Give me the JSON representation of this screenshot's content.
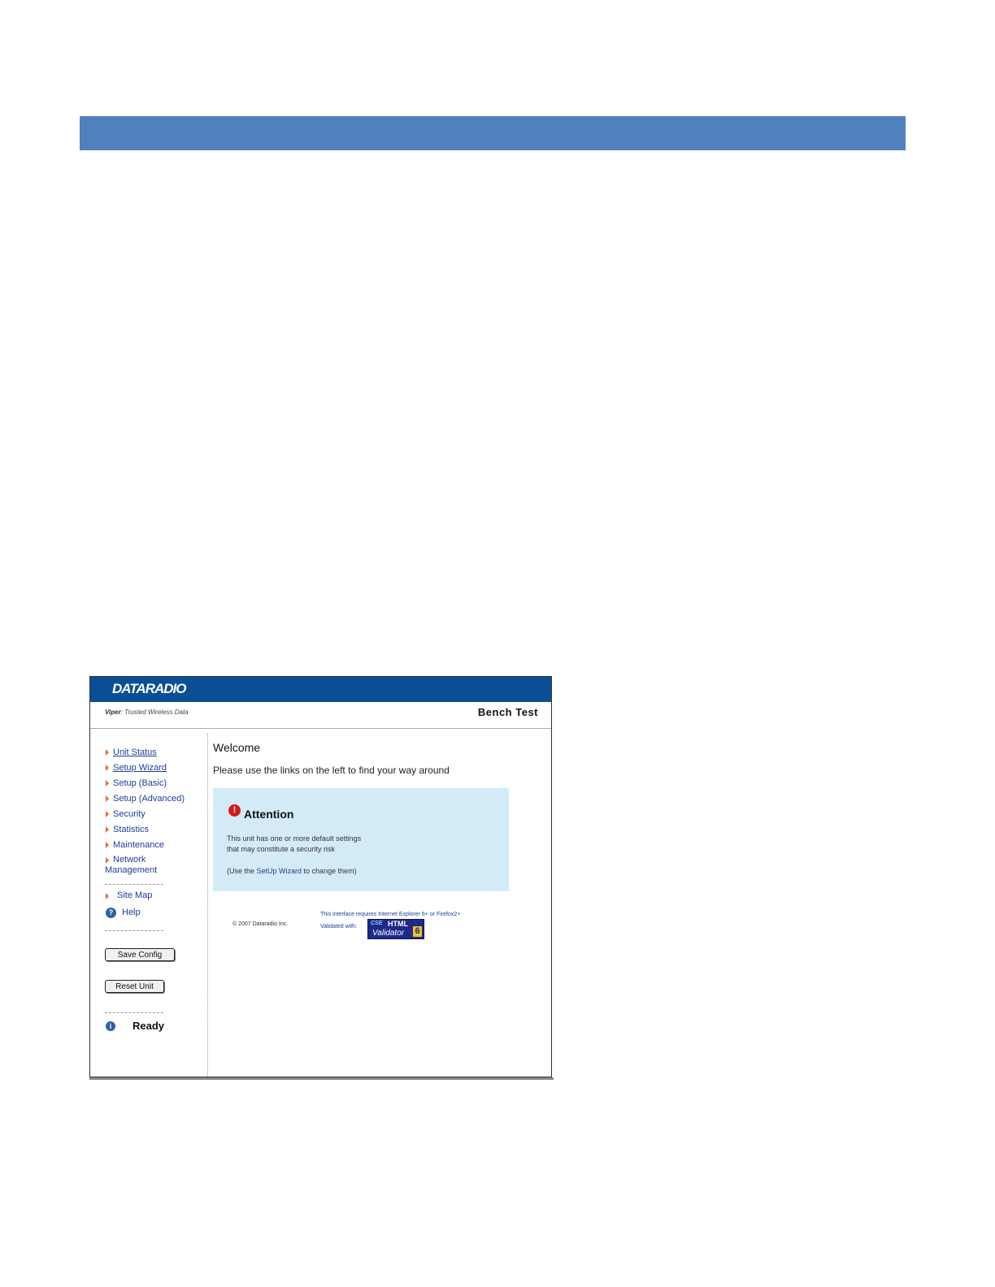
{
  "app": {
    "logo": "DATARADIO",
    "tagline_product": "Viper",
    "tagline_text": ": Trusted Wireless Data",
    "unit_name": "Bench Test"
  },
  "nav": {
    "items": [
      {
        "label": "Unit Status"
      },
      {
        "label": "Setup Wizard"
      },
      {
        "label": "Setup (Basic)"
      },
      {
        "label": "Setup (Advanced)"
      },
      {
        "label": "Security"
      },
      {
        "label": "Statistics"
      },
      {
        "label": "Maintenance"
      },
      {
        "label": "Network Management"
      }
    ],
    "site_map": "Site Map",
    "help": "Help",
    "save_config": "Save Config",
    "reset_unit": "Reset Unit",
    "status": "Ready"
  },
  "main": {
    "title": "Welcome",
    "intro": "Please use the links on the left to find your way around",
    "attention": {
      "title": "Attention",
      "line1": "This unit has one or more default settings",
      "line2": "that may constitute a security risk",
      "line3_prefix": "(Use the ",
      "line3_link": "SetUp Wizard",
      "line3_suffix": " to change them)"
    },
    "footer": {
      "copyright": "© 2007 Dataradio Inc.",
      "requirement": "This interface requires Internet Explorer 6+ or Firefox2+",
      "validated": "Validated with:",
      "badge_cse": "CSE",
      "badge_html": "HTML",
      "badge_validator": "Validator",
      "badge_version": "6"
    }
  },
  "colors": {
    "band": "#4f81bd",
    "topbar": "#0a4f96",
    "attention_bg": "#d2ebf6",
    "nav_arrow": "#e0702a"
  }
}
